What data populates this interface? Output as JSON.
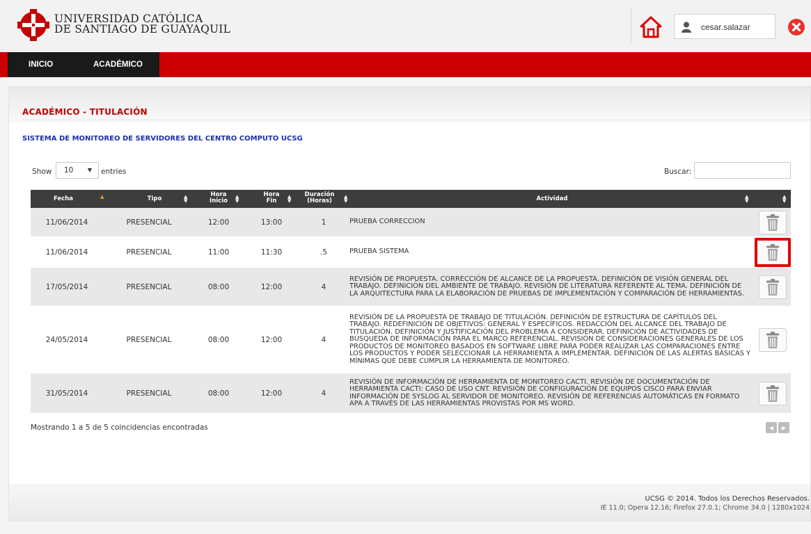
{
  "header": {
    "university_line1": "UNIVERSIDAD CATÓLICA",
    "university_line2": "DE SANTIAGO DE GUAYAQUIL",
    "username": "cesar.salazar",
    "icons": [
      "logo",
      "home-icon",
      "user-icon",
      "close-icon"
    ],
    "colors": {
      "accent": "#cc0000",
      "home": "#e00000",
      "close": "#e8322c"
    }
  },
  "nav": {
    "items": [
      {
        "label": "INICIO"
      },
      {
        "label": "ACADÉMICO"
      }
    ],
    "bar_color": "#cc0000",
    "menu_bg": "#1a1a1a"
  },
  "main": {
    "section_title": "ACADÉMICO - TITULACIÓN",
    "subtitle": "SISTEMA DE MONITOREO DE SERVIDORES DEL CENTRO COMPUTO UCSG",
    "show_label": "Show",
    "entries_value": "10",
    "entries_label": "entries",
    "search_label": "Buscar:",
    "search_value": "",
    "table": {
      "columns": [
        "Fecha",
        "Tipo",
        "Hora Inicio",
        "Hora Fin",
        "Duración (Horas)",
        "Actividad",
        ""
      ],
      "column_headers": [
        {
          "line1": "Fecha",
          "line2": ""
        },
        {
          "line1": "Tipo",
          "line2": ""
        },
        {
          "line1": "Hora",
          "line2": "Inicio"
        },
        {
          "line1": "Hora",
          "line2": "Fin"
        },
        {
          "line1": "Duración",
          "line2": "(Horas)"
        },
        {
          "line1": "Actividad",
          "line2": ""
        },
        {
          "line1": "",
          "line2": ""
        }
      ],
      "rows": [
        {
          "fecha": "11/06/2014",
          "tipo": "PRESENCIAL",
          "inicio": "12:00",
          "fin": "13:00",
          "duracion": "1",
          "actividad": "PRUEBA CORRECCION"
        },
        {
          "fecha": "11/06/2014",
          "tipo": "PRESENCIAL",
          "inicio": "11:00",
          "fin": "11:30",
          "duracion": ".5",
          "actividad": "PRUEBA SISTEMA"
        },
        {
          "fecha": "17/05/2014",
          "tipo": "PRESENCIAL",
          "inicio": "08:00",
          "fin": "12:00",
          "duracion": "4",
          "actividad": "REVISIÓN DE PROPUESTA. CORRECCIÓN DE ALCANCE DE LA PROPUESTA. DEFINICIÓN DE VISIÓN GENERAL DEL TRABAJO. DEFINICIÓN DEL AMBIENTE DE TRABAJO. REVISIÓN DE LITERATURA REFERENTE AL TEMA. DEFINICIÓN DE LA ARQUITECTURA PARA LA ELABORACIÓN DE PRUEBAS DE IMPLEMENTACIÓN Y COMPARACIÓN DE HERRAMIENTAS."
        },
        {
          "fecha": "24/05/2014",
          "tipo": "PRESENCIAL",
          "inicio": "08:00",
          "fin": "12:00",
          "duracion": "4",
          "actividad": "REVISIÓN DE LA PROPUESTA DE TRABAJO DE TITULACIÓN. DEFINICIÓN DE ESTRUCTURA DE CAPÍTULOS DEL TRABAJO. REDEFINICIÓN DE OBJETIVOS: GENERAL Y ESPECÍFICOS. REDACCIÓN DEL ALCANCE DEL TRABAJO DE TITULACIÓN. DEFINICIÓN Y JUSTIFICACIÓN DEL PROBLEMA A CONSIDERAR. DEFINICIÓN DE ACTIVIDADES DE BÚSQUEDA DE INFORMACIÓN PARA EL MARCO REFERENCIAL. REVISIÓN DE CONSIDERACIONES GENERALES DE LOS PRODUCTOS DE MONITOREO BASADOS EN SOFTWARE LIBRE PARA PODER REALIZAR LAS COMPARACIONES ENTRE LOS PRODUCTOS Y PODER SELECCIONAR LA HERRAMIENTA A IMPLEMENTAR. DEFINICIÓN DE LAS ALERTAS BÁSICAS Y MÍNIMAS QUE DEBE CUMPLIR LA HERRAMIENTA DE MONITOREO."
        },
        {
          "fecha": "31/05/2014",
          "tipo": "PRESENCIAL",
          "inicio": "08:00",
          "fin": "12:00",
          "duracion": "4",
          "actividad": "REVISIÓN DE INFORMACIÓN DE HERRAMIENTA DE MONITOREO CACTI. REVISIÓN DE DOCUMENTACIÓN DE HERRAMIENTA CACTI: CASO DE USO CNT. REVISIÓN DE CONFIGURACIÓN DE EQUIPOS CISCO PARA ENVIAR INFORMACIÓN DE SYSLOG AL SERVIDOR DE MONITOREO. REVISIÓN DE REFERENCIAS AUTOMÁTICAS EN FORMATO APA A TRAVÉS DE LAS HERRAMIENTAS PROVISTAS POR MS WORD."
        }
      ]
    },
    "info_text": "Mostrando 1 a 5 de 5 coincidencias encontradas"
  },
  "footer": {
    "line1": "UCSG © 2014. Todos los Derechos Reservados.",
    "line2": "IE 11.0; Opera 12.16; Firefox 27.0.1; Chrome 34.0 | 1280x1024"
  }
}
